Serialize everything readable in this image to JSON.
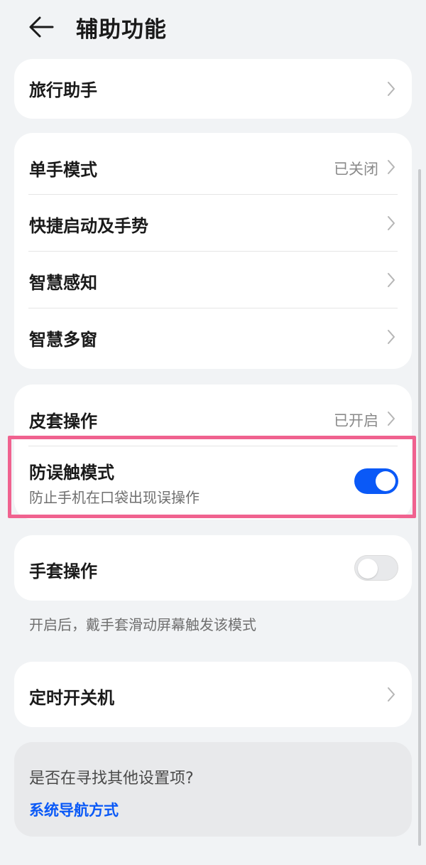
{
  "header": {
    "title": "辅助功能",
    "back_icon": "arrow-left-icon"
  },
  "section1": {
    "travel": {
      "label": "旅行助手"
    }
  },
  "section2": {
    "items": [
      {
        "label": "单手模式",
        "value": "已关闭"
      },
      {
        "label": "快捷启动及手势"
      },
      {
        "label": "智慧感知"
      },
      {
        "label": "智慧多窗"
      }
    ]
  },
  "section3": {
    "cover": {
      "label": "皮套操作",
      "value": "已开启"
    },
    "mistouch": {
      "label": "防误触模式",
      "sublabel": "防止手机在口袋出现误操作",
      "enabled": true
    }
  },
  "section4": {
    "glove": {
      "label": "手套操作",
      "enabled": false
    },
    "note": "开启后，戴手套滑动屏幕触发该模式"
  },
  "section5": {
    "timer": {
      "label": "定时开关机"
    }
  },
  "suggest": {
    "question": "是否在寻找其他设置项?",
    "link": "系统导航方式"
  },
  "colors": {
    "accent": "#0a59f7",
    "highlight": "#f0628f",
    "background": "#f1f3f5"
  }
}
